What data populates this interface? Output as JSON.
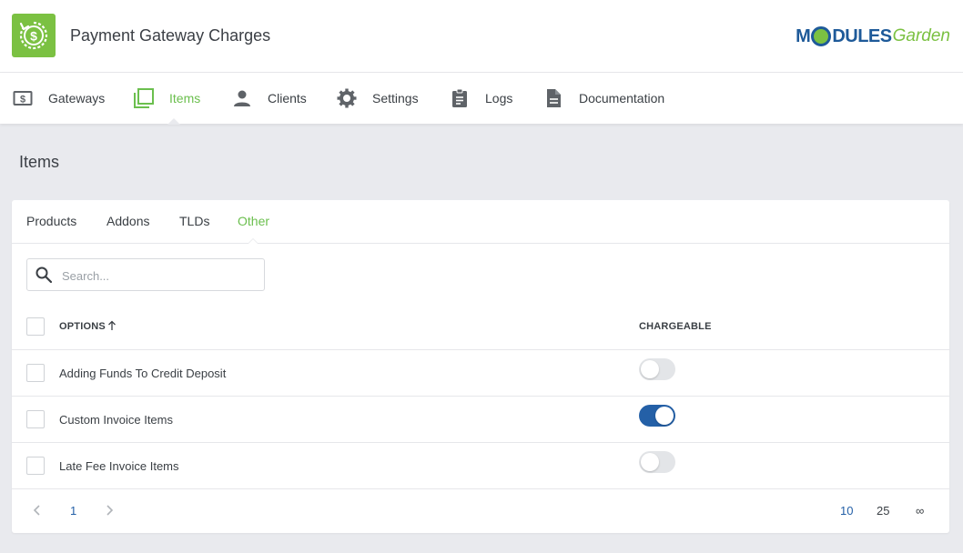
{
  "app": {
    "title": "Payment Gateway Charges",
    "brand": {
      "part1": "M",
      "part2": "DULES",
      "part3": "Garden"
    }
  },
  "nav": {
    "items": [
      {
        "label": "Gateways",
        "icon": "money-icon"
      },
      {
        "label": "Items",
        "icon": "items-icon"
      },
      {
        "label": "Clients",
        "icon": "user-icon"
      },
      {
        "label": "Settings",
        "icon": "gear-icon"
      },
      {
        "label": "Logs",
        "icon": "clipboard-icon"
      },
      {
        "label": "Documentation",
        "icon": "document-icon"
      }
    ],
    "active": "Items"
  },
  "page": {
    "title": "Items"
  },
  "subtabs": {
    "items": [
      "Products",
      "Addons",
      "TLDs",
      "Other"
    ],
    "active": "Other"
  },
  "search": {
    "placeholder": "Search...",
    "value": ""
  },
  "table": {
    "columns": {
      "options": "OPTIONS",
      "chargeable": "CHARGEABLE"
    },
    "sort": "ascending",
    "rows": [
      {
        "label": "Adding Funds To Credit Deposit",
        "chargeable": false
      },
      {
        "label": "Custom Invoice Items",
        "chargeable": true
      },
      {
        "label": "Late Fee Invoice Items",
        "chargeable": false
      }
    ]
  },
  "pagination": {
    "current_page": "1",
    "page_sizes": [
      "10",
      "25",
      "∞"
    ],
    "active_size": "10"
  },
  "colors": {
    "accent_green": "#6bbf4e",
    "app_icon_green": "#7bc142",
    "toggle_on_blue": "#2460a7",
    "brand_blue": "#1e5a99"
  }
}
